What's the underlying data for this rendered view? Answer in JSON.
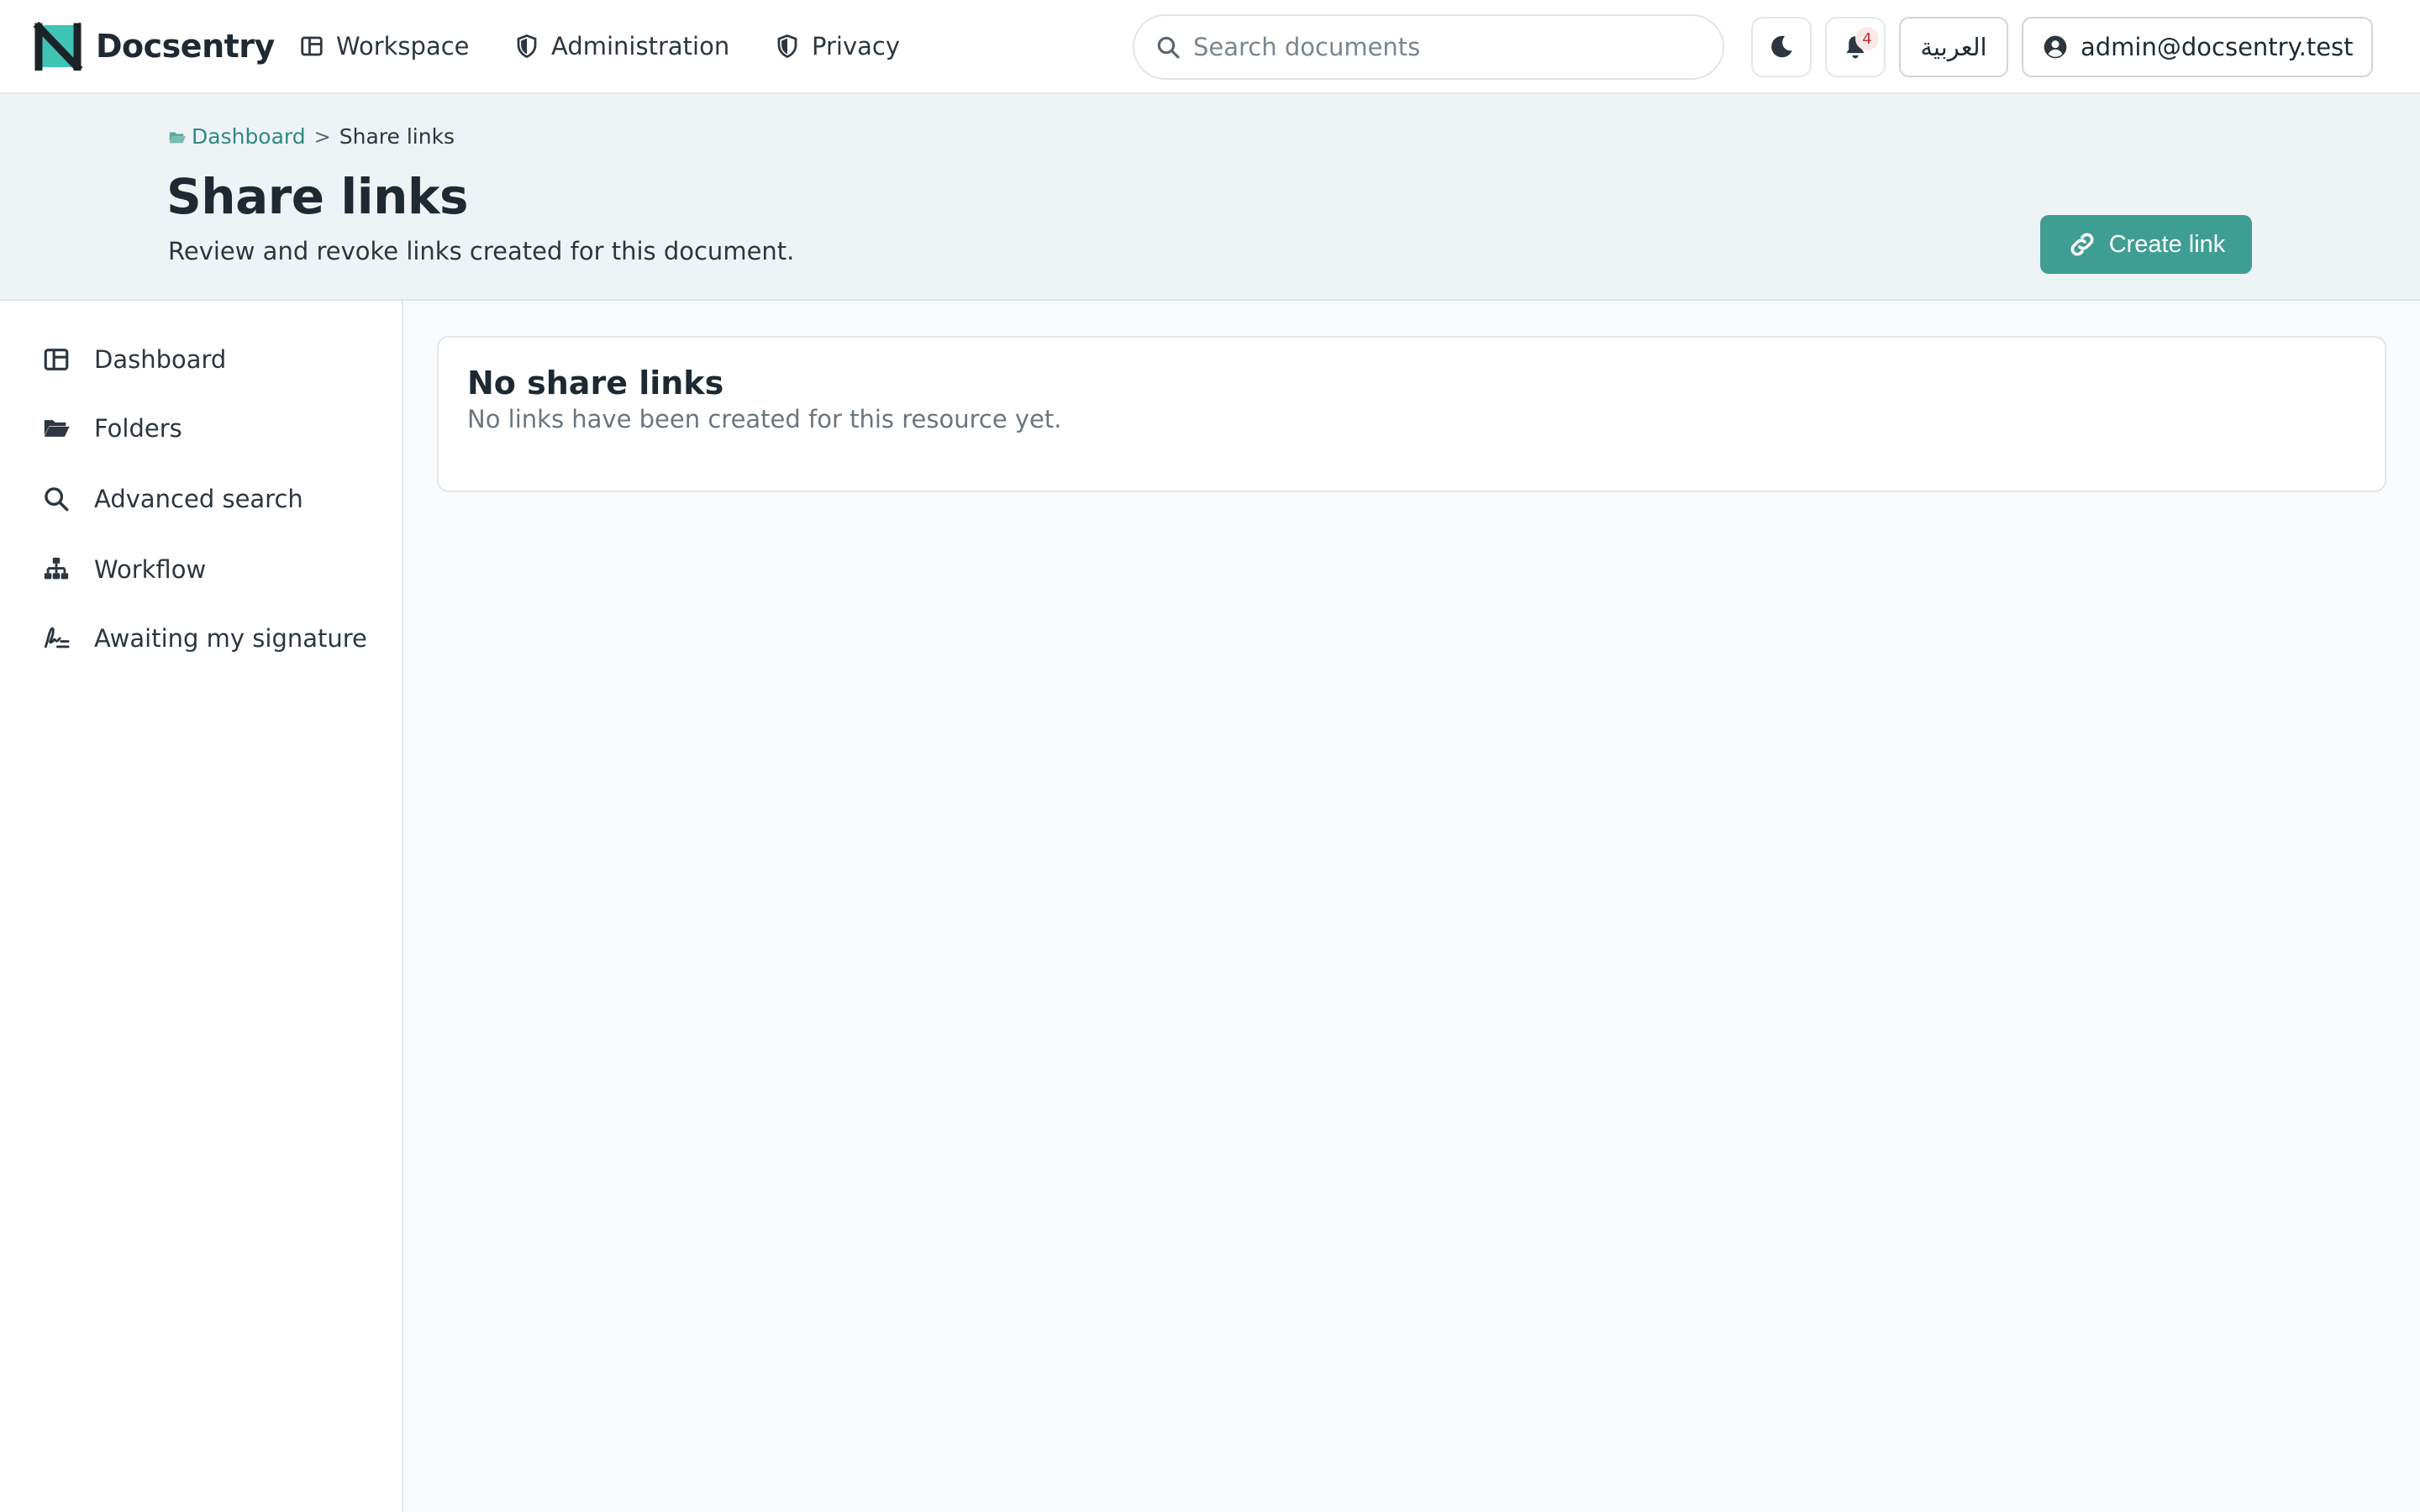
{
  "app": {
    "name": "Docsentry"
  },
  "nav": {
    "items": [
      {
        "label": "Workspace",
        "icon": "layout-icon"
      },
      {
        "label": "Administration",
        "icon": "shield-icon"
      },
      {
        "label": "Privacy",
        "icon": "shield-icon"
      }
    ]
  },
  "search": {
    "placeholder": "Search documents",
    "value": ""
  },
  "header_actions": {
    "theme_icon": "moon-icon",
    "notifications_count": "4",
    "language_label": "العربية",
    "user_email": "admin@docsentry.test"
  },
  "breadcrumb": {
    "parent": "Dashboard",
    "separator": ">",
    "current": "Share links"
  },
  "page": {
    "title": "Share links",
    "subtitle": "Review and revoke links created for this document.",
    "create_button_label": "Create link"
  },
  "sidebar": {
    "items": [
      {
        "label": "Dashboard",
        "icon": "dashboard-icon"
      },
      {
        "label": "Folders",
        "icon": "folder-icon"
      },
      {
        "label": "Advanced search",
        "icon": "search-icon"
      },
      {
        "label": "Workflow",
        "icon": "workflow-icon"
      },
      {
        "label": "Awaiting my signature",
        "icon": "signature-icon"
      }
    ]
  },
  "empty_state": {
    "title": "No share links",
    "message": "No links have been created for this resource yet."
  },
  "colors": {
    "accent": "#3f9e93",
    "link": "#2f8a7e",
    "header_bg": "#eef4f6",
    "badge_bg": "#fde8e8",
    "badge_text": "#c53030"
  }
}
